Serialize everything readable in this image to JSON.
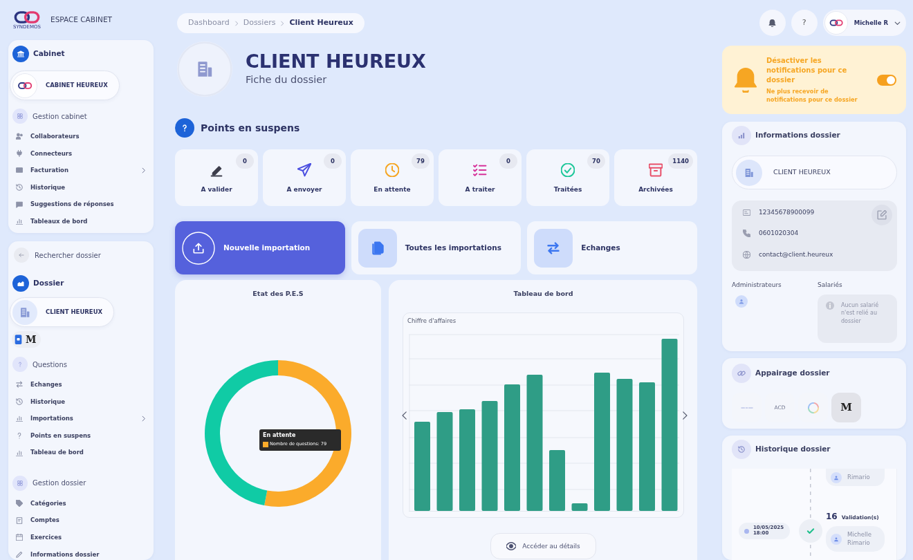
{
  "brand": {
    "caption": "SYNDEMOS",
    "title": "ESPACE CABINET"
  },
  "sidebar": {
    "cabinet": {
      "heading": "Cabinet",
      "name": "CABINET HEUREUX",
      "sections": [
        {
          "title": "Gestion cabinet",
          "items": [
            {
              "label": "Collaborateurs",
              "kind": "link"
            },
            {
              "label": "Connecteurs",
              "kind": "link"
            },
            {
              "label": "Facturation",
              "kind": "submenu"
            },
            {
              "label": "Historique",
              "kind": "link"
            },
            {
              "label": "Suggestions de réponses",
              "kind": "link"
            },
            {
              "label": "Tableaux de bord",
              "kind": "link"
            }
          ]
        }
      ]
    },
    "dossier": {
      "back_label": "Rechercher dossier",
      "heading": "Dossier",
      "name": "CLIENT HEUREUX",
      "software": "M",
      "sections": [
        {
          "title": "Questions",
          "items": [
            {
              "label": "Echanges",
              "kind": "link"
            },
            {
              "label": "Historique",
              "kind": "link"
            },
            {
              "label": "Importations",
              "kind": "submenu"
            },
            {
              "label": "Points en suspens",
              "kind": "link"
            },
            {
              "label": "Tableau de bord",
              "kind": "link"
            }
          ]
        },
        {
          "title": "Gestion dossier",
          "items": [
            {
              "label": "Catégories",
              "kind": "link"
            },
            {
              "label": "Comptes",
              "kind": "link"
            },
            {
              "label": "Exercices",
              "kind": "link"
            },
            {
              "label": "Informations dossier",
              "kind": "link"
            }
          ]
        }
      ]
    }
  },
  "breadcrumb": [
    {
      "label": "Dashboard",
      "current": false
    },
    {
      "label": "Dossiers",
      "current": false
    },
    {
      "label": "Client Heureux",
      "current": true
    }
  ],
  "header": {
    "title": "CLIENT HEUREUX",
    "subtitle": "Fiche du dossier"
  },
  "pending": {
    "title": "Points en suspens",
    "stats": [
      {
        "label": "A valider",
        "count": "0",
        "color": "#3d3e4c"
      },
      {
        "label": "A envoyer",
        "count": "0",
        "color": "#4b4fe0"
      },
      {
        "label": "En attente",
        "count": "79",
        "color": "#f5a623"
      },
      {
        "label": "A traiter",
        "count": "0",
        "color": "#d6339a"
      },
      {
        "label": "Traitées",
        "count": "70",
        "color": "#1fc79a"
      },
      {
        "label": "Archivées",
        "count": "1140",
        "color": "#e8506a"
      }
    ]
  },
  "actions": [
    {
      "label": "Nouvelle importation",
      "selected": true
    },
    {
      "label": "Toutes les importations",
      "selected": false
    },
    {
      "label": "Echanges",
      "selected": false
    }
  ],
  "status_chart": {
    "title": "Etat des P.E.S",
    "chart_data": {
      "type": "donut",
      "values": [
        53,
        47
      ],
      "colors": [
        "#fbab2b",
        "#10cba5"
      ]
    },
    "tooltip": {
      "title": "En attente",
      "text": "Nombre de questions: 79"
    }
  },
  "dashboard": {
    "title": "Tableau de bord",
    "chart_title": "Chiffre d'affaires",
    "details_button": "Accéder au détails"
  },
  "topbar": {
    "help": "?",
    "user": "Michelle R"
  },
  "notifications": {
    "title": "Désactiver les notifications pour ce dossier",
    "subtitle": "Ne plus recevoir de notifications pour ce dossier",
    "on": true
  },
  "info": {
    "title": "Informations dossier",
    "name": "CLIENT HEUREUX",
    "contacts": [
      {
        "kind": "id",
        "value": "12345678900099"
      },
      {
        "kind": "phone",
        "value": "0601020304"
      },
      {
        "kind": "web",
        "value": "contact@client.heureux"
      }
    ],
    "admins_label": "Administrateurs",
    "employees_label": "Salariés",
    "employees_empty": "Aucun salarié n'est relié au dossier"
  },
  "pairing": {
    "title": "Appairage dossier",
    "tiles": [
      {
        "kind": "wordmark",
        "active": false
      },
      {
        "kind": "text",
        "label": "ACD",
        "active": false
      },
      {
        "kind": "ring",
        "active": false
      },
      {
        "kind": "text",
        "label": "M",
        "active": true
      }
    ]
  },
  "history": {
    "title": "Historique dossier",
    "entries": [
      {
        "user": "Rimario"
      },
      {
        "date": "10/05/2025 18:00",
        "count": "16",
        "action": "Validation(s)",
        "user": "Michelle Rimario"
      }
    ]
  }
}
